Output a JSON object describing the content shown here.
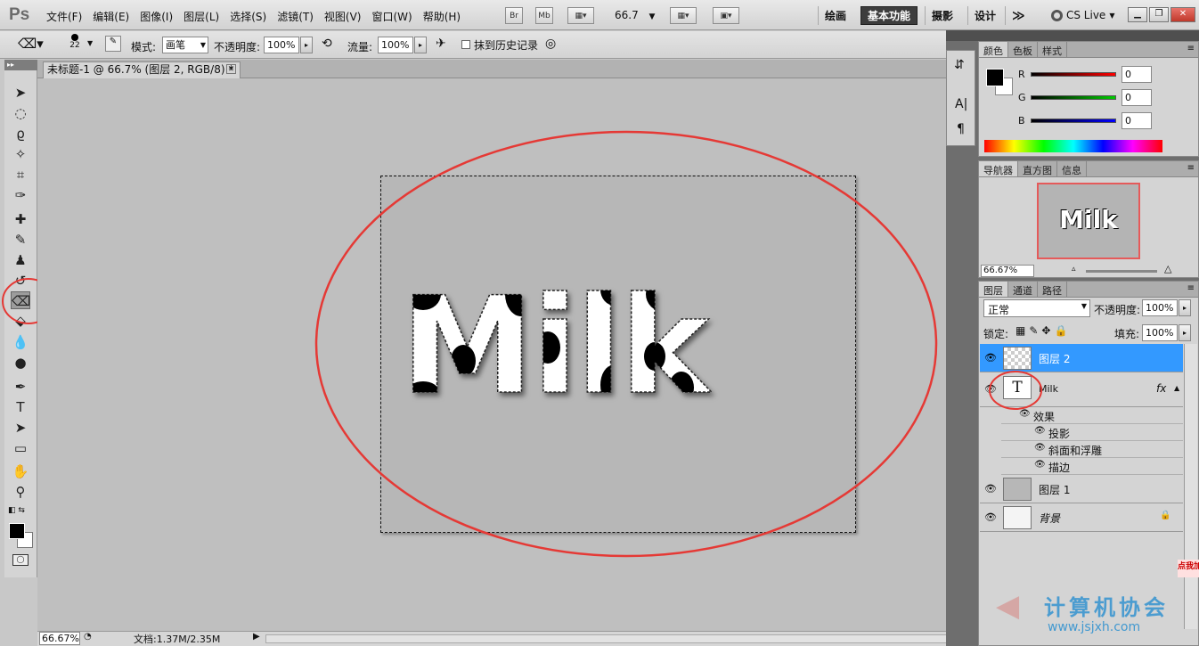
{
  "app": {
    "logo": "Ps"
  },
  "menu": [
    "文件(F)",
    "编辑(E)",
    "图像(I)",
    "图层(L)",
    "选择(S)",
    "滤镜(T)",
    "视图(V)",
    "窗口(W)",
    "帮助(H)"
  ],
  "menubar": {
    "br": "Br",
    "mb": "Mb",
    "zoom": "66.7",
    "zoom_arrow": "▼"
  },
  "workspaces": [
    "绘画",
    "基本功能",
    "摄影",
    "设计"
  ],
  "more": "≫",
  "cslive": "CS Live",
  "options": {
    "brush_size": "22",
    "mode_label": "模式:",
    "mode_value": "画笔",
    "opacity_label": "不透明度:",
    "opacity_value": "100%",
    "flow_label": "流量:",
    "flow_value": "100%",
    "erase_history": "抹到历史记录"
  },
  "document": {
    "tab": "未标题-1 @ 66.7% (图层 2, RGB/8) *",
    "text": "Milk"
  },
  "status": {
    "zoom": "66.67%",
    "doc": "文档:1.37M/2.35M"
  },
  "color_panel": {
    "tabs": [
      "颜色",
      "色板",
      "样式"
    ],
    "r_label": "R",
    "g_label": "G",
    "b_label": "B",
    "r": "0",
    "g": "0",
    "b": "0"
  },
  "navigator_panel": {
    "tabs": [
      "导航器",
      "直方图",
      "信息"
    ],
    "zoom": "66.67%"
  },
  "layers_panel": {
    "tabs": [
      "图层",
      "通道",
      "路径"
    ],
    "blend_mode": "正常",
    "opacity_label": "不透明度:",
    "opacity": "100%",
    "lock_label": "锁定:",
    "fill_label": "填充:",
    "fill": "100%",
    "layers": [
      {
        "name": "图层 2"
      },
      {
        "name": "Milk",
        "fx": "fx"
      },
      {
        "name": "图层 1"
      },
      {
        "name": "背景"
      }
    ],
    "effects_label": "效果",
    "effects": [
      "投影",
      "斜面和浮雕",
      "描边"
    ]
  },
  "watermark": {
    "text": "计算机协会",
    "url": "www.jsjxh.com",
    "badge": "点我加"
  },
  "colors": {
    "accent": "#3399ff",
    "annotation": "#e53935",
    "ui_bg": "#d4d4d4"
  }
}
